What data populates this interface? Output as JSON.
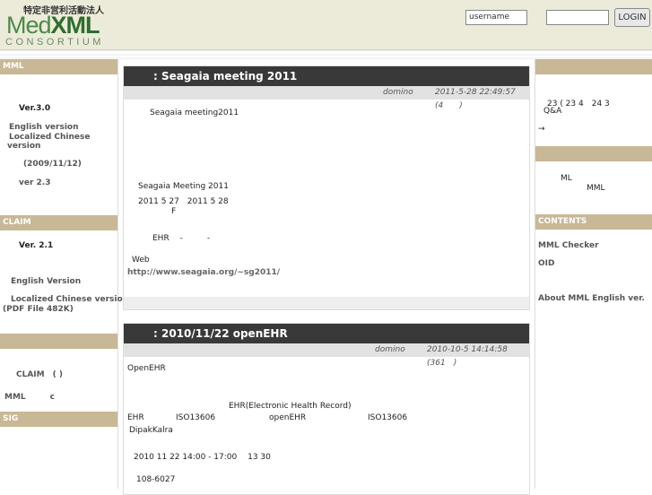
{
  "header": {
    "logo_small": "特定非営利活動法人",
    "logo_med": "Med",
    "logo_xml": "XML",
    "logo_consortium": "CONSORTIUM",
    "username_placeholder": "username",
    "login_label": "LOGIN"
  },
  "left": {
    "mml": {
      "head": "MML",
      "ver": "Ver.3.0",
      "en": "English version",
      "zh": "Localized Chinese version",
      "date": "(2009/11/12)",
      "ver23": "ver 2.3"
    },
    "claim": {
      "head": "CLAIM",
      "ver": "Ver. 2.1",
      "en": "English Version",
      "zh": "Localized Chinese version",
      "pdf": "(PDF File 482K)"
    },
    "blank": {
      "line1": "CLAIM　( )",
      "line2": "MML　　　c"
    },
    "sig": {
      "head": "SIG"
    }
  },
  "right": {
    "top": {
      "line1": "23 ( 23 4　24 3",
      "line2": "Q&A",
      "arrow": "→"
    },
    "mid": {
      "line1": "ML",
      "line2": "MML"
    },
    "contents": {
      "head": "CONTENTS",
      "item1": "MML Checker",
      "item2": "OID",
      "item3": "About MML English ver."
    }
  },
  "articles": [
    {
      "title": ": Seagaia meeting 2011",
      "author": "domino",
      "date": "2011-5-28 22:49:57 (4　　)",
      "lines": [
        "Seagaia meeting2011",
        "Seagaia Meeting 2011",
        "2011 5 27　2011 5 28",
        "F",
        "EHR　 -　　　-",
        "Web",
        "http://www.seagaia.org/~sg2011/"
      ]
    },
    {
      "title": ": 2010/11/22  openEHR",
      "author": "domino",
      "date": "2010-10-5 14:14:58 (361　)",
      "lines": [
        "OpenEHR",
        "EHR(Electronic Health Record)",
        "EHR",
        "ISO13606",
        "openEHR",
        "ISO13606",
        "DipakKalra",
        "2010 11 22  14:00 - 17:00　 13 30",
        "108-6027"
      ]
    }
  ]
}
